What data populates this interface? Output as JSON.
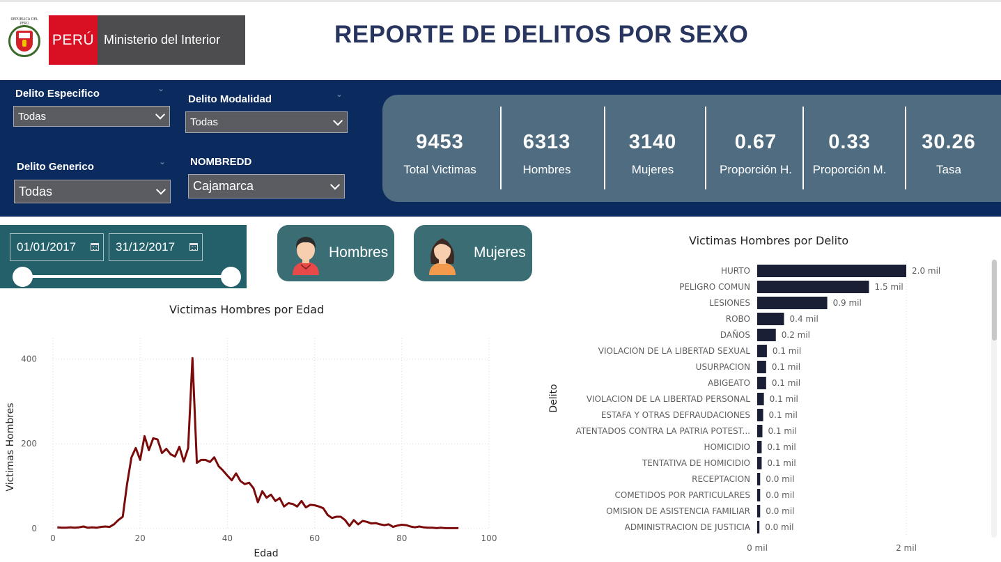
{
  "header": {
    "crest_caption": "REPÚBLICA DEL PERÚ",
    "brand": "PERÚ",
    "ministry": "Ministerio del Interior",
    "title": "REPORTE DE DELITOS POR SEXO"
  },
  "filters": {
    "delito_especifico": {
      "label": "Delito Especifico",
      "value": "Todas"
    },
    "delito_modalidad": {
      "label": "Delito Modalidad",
      "value": "Todas"
    },
    "delito_generico": {
      "label": "Delito Generico",
      "value": "Todas"
    },
    "nombredd": {
      "label": "NOMBREDD",
      "value": "Cajamarca"
    }
  },
  "kpis": [
    {
      "value": "9453",
      "label": "Total Victimas"
    },
    {
      "value": "6313",
      "label": "Hombres"
    },
    {
      "value": "3140",
      "label": "Mujeres"
    },
    {
      "value": "0.67",
      "label": "Proporción H."
    },
    {
      "value": "0.33",
      "label": "Proporción M."
    },
    {
      "value": "30.26",
      "label": "Tasa"
    }
  ],
  "date_range": {
    "start": "01/01/2017",
    "end": "31/12/2017",
    "slider_start_fraction": 0,
    "slider_end_fraction": 1
  },
  "buttons": {
    "hombres": "Hombres",
    "mujeres": "Mujeres"
  },
  "colors": {
    "band": "#0b2a5e",
    "kpi": "#4f6c80",
    "line": "#7b0a0a",
    "bar": "#1b1f36",
    "button": "#3b6e74"
  },
  "chart_data": [
    {
      "type": "line",
      "title": "Victimas Hombres por Edad",
      "xlabel": "Edad",
      "ylabel": "Victimas Hombres",
      "xlim": [
        0,
        100
      ],
      "ylim": [
        0,
        450
      ],
      "xticks": [
        0,
        20,
        40,
        60,
        80,
        100
      ],
      "yticks": [
        0,
        200,
        400
      ],
      "grid": true,
      "x": [
        1,
        2,
        3,
        4,
        5,
        6,
        7,
        8,
        9,
        10,
        11,
        12,
        13,
        14,
        15,
        16,
        17,
        18,
        19,
        20,
        21,
        22,
        23,
        24,
        25,
        26,
        27,
        28,
        29,
        30,
        31,
        32,
        33,
        34,
        35,
        36,
        37,
        38,
        39,
        40,
        41,
        42,
        43,
        44,
        45,
        46,
        47,
        48,
        49,
        50,
        51,
        52,
        53,
        54,
        55,
        56,
        57,
        58,
        59,
        60,
        61,
        62,
        63,
        64,
        65,
        66,
        67,
        68,
        69,
        70,
        71,
        72,
        73,
        74,
        75,
        76,
        77,
        78,
        79,
        80,
        81,
        82,
        83,
        84,
        85,
        86,
        87,
        88,
        89,
        90,
        91,
        92,
        93
      ],
      "y": [
        3,
        2,
        2,
        3,
        2,
        3,
        5,
        2,
        3,
        2,
        4,
        5,
        4,
        10,
        20,
        28,
        105,
        168,
        190,
        162,
        218,
        185,
        213,
        210,
        178,
        188,
        175,
        170,
        193,
        158,
        190,
        402,
        155,
        162,
        162,
        157,
        168,
        147,
        137,
        125,
        114,
        130,
        112,
        105,
        108,
        95,
        62,
        88,
        73,
        80,
        65,
        72,
        52,
        60,
        58,
        52,
        65,
        50,
        56,
        55,
        52,
        48,
        32,
        25,
        28,
        28,
        20,
        6,
        20,
        10,
        18,
        16,
        12,
        13,
        10,
        8,
        10,
        4,
        7,
        9,
        8,
        5,
        3,
        5,
        3,
        2,
        2,
        1,
        2,
        1,
        1,
        1,
        1
      ]
    },
    {
      "type": "bar",
      "orientation": "horizontal",
      "title": "Victimas Hombres por Delito",
      "ylabel": "Delito",
      "xlim": [
        0,
        2
      ],
      "xticks": [
        "0 mil",
        "2 mil"
      ],
      "categories": [
        "HURTO",
        "PELIGRO COMUN",
        "LESIONES",
        "ROBO",
        "DAÑOS",
        "VIOLACION DE LA LIBERTAD SEXUAL",
        "USURPACION",
        "ABIGEATO",
        "VIOLACION DE LA LIBERTAD PERSONAL",
        "ESTAFA Y OTRAS DEFRAUDACIONES",
        "ATENTADOS CONTRA LA PATRIA POTEST...",
        "HOMICIDIO",
        "TENTATIVA DE HOMICIDIO",
        "RECEPTACION",
        "COMETIDOS POR PARTICULARES",
        "OMISION DE ASISTENCIA FAMILIAR",
        "ADMINISTRACION DE JUSTICIA"
      ],
      "values": [
        2.0,
        1.5,
        0.94,
        0.36,
        0.25,
        0.13,
        0.12,
        0.12,
        0.09,
        0.08,
        0.07,
        0.06,
        0.06,
        0.04,
        0.04,
        0.04,
        0.03
      ],
      "labels": [
        "2.0 mil",
        "1.5 mil",
        "0.9 mil",
        "0.4 mil",
        "0.2 mil",
        "0.1 mil",
        "0.1 mil",
        "0.1 mil",
        "0.1 mil",
        "0.1 mil",
        "0.1 mil",
        "0.1 mil",
        "0.1 mil",
        "0.0 mil",
        "0.0 mil",
        "0.0 mil",
        "0.0 mil"
      ]
    }
  ]
}
